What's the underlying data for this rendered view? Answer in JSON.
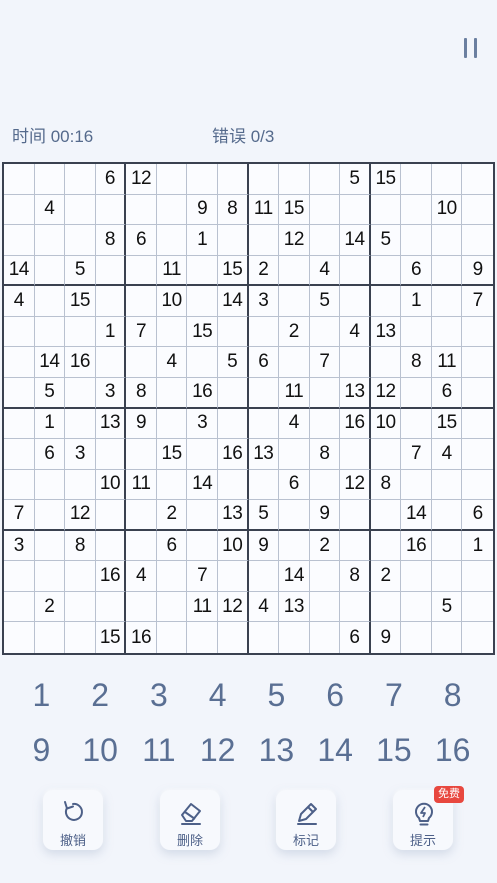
{
  "header": {
    "timer_label": "时间 00:16",
    "errors_label": "错误 0/3"
  },
  "board": {
    "size": 16,
    "box_size": 4,
    "rows": [
      [
        "",
        "",
        "",
        "6",
        "12",
        "",
        "",
        "",
        "",
        "",
        "",
        "5",
        "15",
        "",
        "",
        ""
      ],
      [
        "",
        "4",
        "",
        "",
        "",
        "",
        "9",
        "8",
        "11",
        "15",
        "",
        "",
        "",
        "",
        "10",
        ""
      ],
      [
        "",
        "",
        "",
        "8",
        "6",
        "",
        "1",
        "",
        "",
        "12",
        "",
        "14",
        "5",
        "",
        "",
        ""
      ],
      [
        "14",
        "",
        "5",
        "",
        "",
        "11",
        "",
        "15",
        "2",
        "",
        "4",
        "",
        "",
        "6",
        "",
        "9"
      ],
      [
        "4",
        "",
        "15",
        "",
        "",
        "10",
        "",
        "14",
        "3",
        "",
        "5",
        "",
        "",
        "1",
        "",
        "7"
      ],
      [
        "",
        "",
        "",
        "1",
        "7",
        "",
        "15",
        "",
        "",
        "2",
        "",
        "4",
        "13",
        "",
        "",
        ""
      ],
      [
        "",
        "14",
        "16",
        "",
        "",
        "4",
        "",
        "5",
        "6",
        "",
        "7",
        "",
        "",
        "8",
        "11",
        ""
      ],
      [
        "",
        "5",
        "",
        "3",
        "8",
        "",
        "16",
        "",
        "",
        "11",
        "",
        "13",
        "12",
        "",
        "6",
        ""
      ],
      [
        "",
        "1",
        "",
        "13",
        "9",
        "",
        "3",
        "",
        "",
        "4",
        "",
        "16",
        "10",
        "",
        "15",
        ""
      ],
      [
        "",
        "6",
        "3",
        "",
        "",
        "15",
        "",
        "16",
        "13",
        "",
        "8",
        "",
        "",
        "7",
        "4",
        ""
      ],
      [
        "",
        "",
        "",
        "10",
        "11",
        "",
        "14",
        "",
        "",
        "6",
        "",
        "12",
        "8",
        "",
        "",
        ""
      ],
      [
        "7",
        "",
        "12",
        "",
        "",
        "2",
        "",
        "13",
        "5",
        "",
        "9",
        "",
        "",
        "14",
        "",
        "6"
      ],
      [
        "3",
        "",
        "8",
        "",
        "",
        "6",
        "",
        "10",
        "9",
        "",
        "2",
        "",
        "",
        "16",
        "",
        "1"
      ],
      [
        "",
        "",
        "",
        "16",
        "4",
        "",
        "7",
        "",
        "",
        "14",
        "",
        "8",
        "2",
        "",
        "",
        ""
      ],
      [
        "",
        "2",
        "",
        "",
        "",
        "",
        "11",
        "12",
        "4",
        "13",
        "",
        "",
        "",
        "",
        "5",
        ""
      ],
      [
        "",
        "",
        "",
        "15",
        "16",
        "",
        "",
        "",
        "",
        "",
        "",
        "6",
        "9",
        "",
        "",
        ""
      ]
    ]
  },
  "numpad": [
    "1",
    "2",
    "3",
    "4",
    "5",
    "6",
    "7",
    "8",
    "9",
    "10",
    "11",
    "12",
    "13",
    "14",
    "15",
    "16"
  ],
  "tools": {
    "undo_label": "撤销",
    "erase_label": "删除",
    "note_label": "标记",
    "hint_label": "提示",
    "hint_badge": "免费"
  },
  "colors": {
    "background": "#f2f5fb",
    "grid_thick": "#3a4150",
    "grid_thin": "#b9c1d0",
    "numpad_text": "#5a6f93",
    "badge": "#e8483f"
  }
}
